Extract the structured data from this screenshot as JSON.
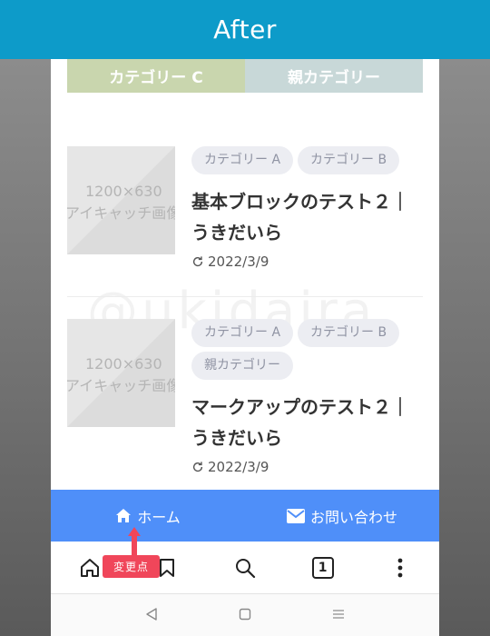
{
  "banner": {
    "title": "After"
  },
  "category_strip": {
    "left": "カテゴリー C",
    "right": "親カテゴリー"
  },
  "watermark": "@ukidaira",
  "articles": [
    {
      "thumb_line1": "1200×630",
      "thumb_line2": "アイキャッチ画像",
      "tags": [
        "カテゴリー A",
        "カテゴリー B"
      ],
      "title": "基本ブロックのテスト２｜うきだいら",
      "date": "2022/3/9"
    },
    {
      "thumb_line1": "1200×630",
      "thumb_line2": "アイキャッチ画像",
      "tags": [
        "カテゴリー A",
        "カテゴリー B",
        "親カテゴリー"
      ],
      "title": "マークアップのテスト２｜うきだいら",
      "date": "2022/3/9"
    }
  ],
  "fixed_menu": {
    "home_label": "ホーム",
    "contact_label": "お問い合わせ"
  },
  "browser_bar": {
    "tab_count": "1"
  },
  "annotation": {
    "label": "変更点"
  },
  "colors": {
    "banner": "#0d9bc9",
    "menu": "#4f8ff9",
    "callout": "#f0465a"
  }
}
